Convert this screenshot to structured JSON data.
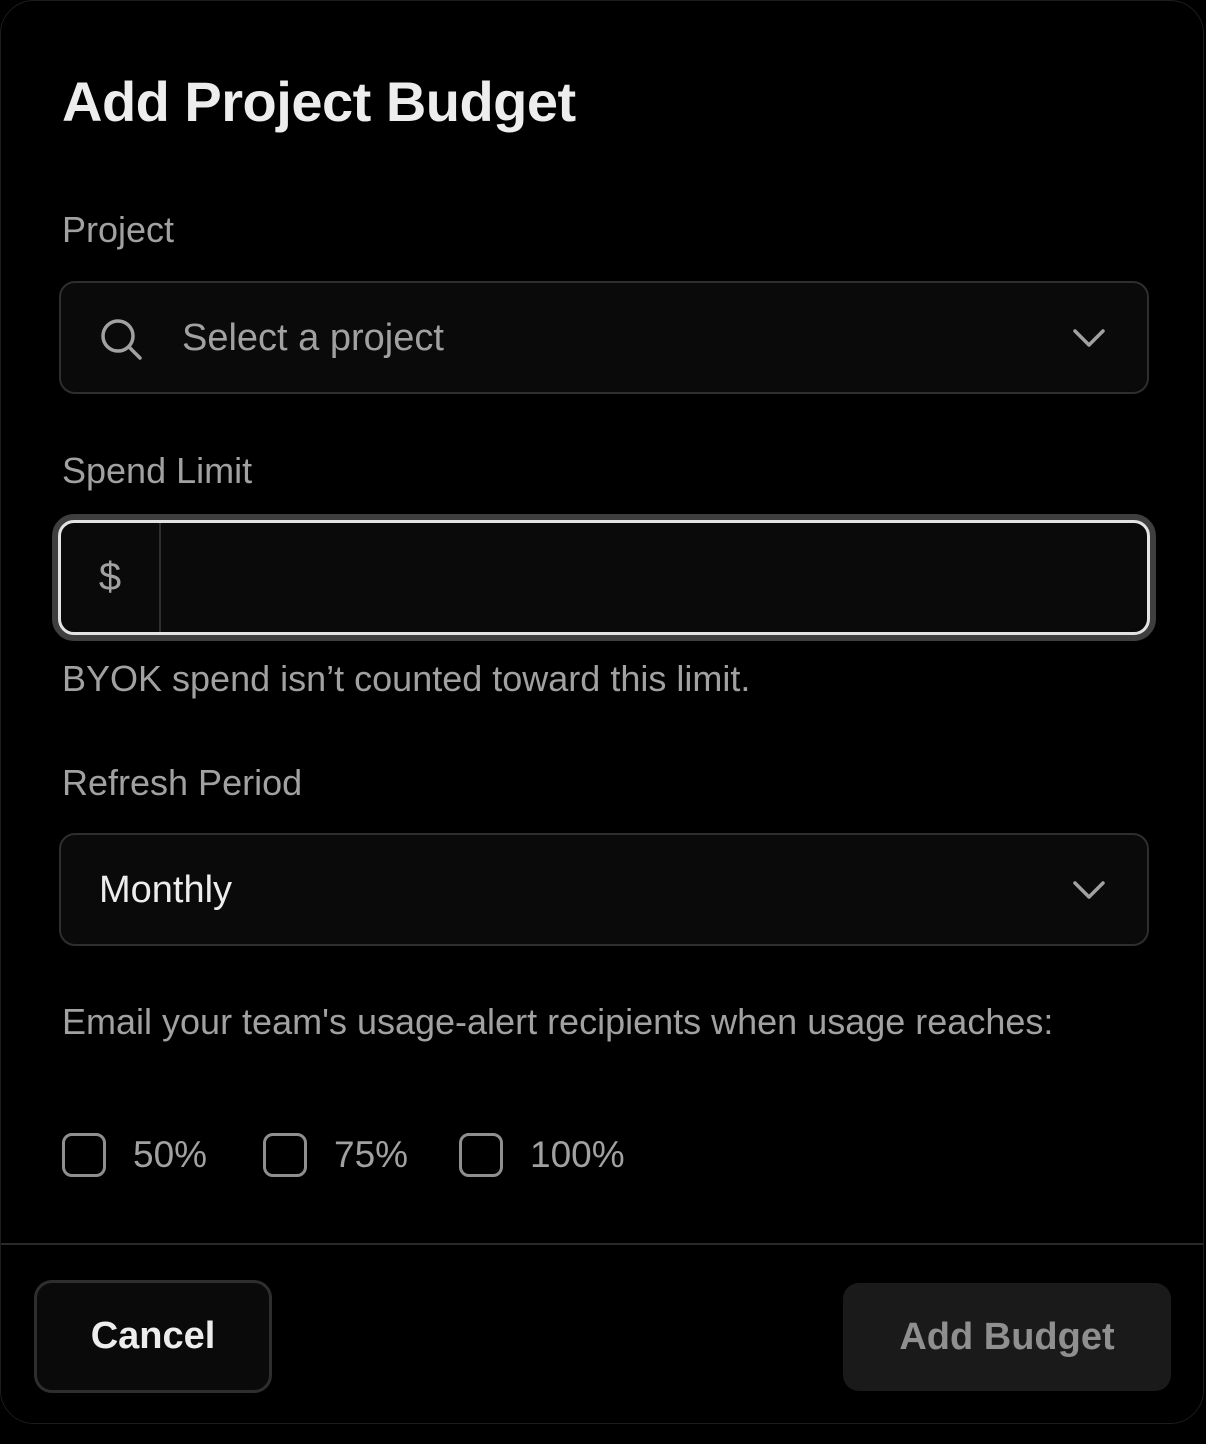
{
  "dialog": {
    "title": "Add Project Budget"
  },
  "project": {
    "label": "Project",
    "placeholder": "Select a project",
    "icon": "search-icon",
    "chevron_icon": "chevron-down-icon"
  },
  "spend_limit": {
    "label": "Spend Limit",
    "currency_symbol": "$",
    "value": "",
    "hint": "BYOK spend isn’t counted toward this limit."
  },
  "refresh_period": {
    "label": "Refresh Period",
    "selected": "Monthly",
    "chevron_icon": "chevron-down-icon"
  },
  "alerts": {
    "description": "Email your team's usage-alert recipients when usage reaches:",
    "options": [
      {
        "label": "50%",
        "checked": false
      },
      {
        "label": "75%",
        "checked": false
      },
      {
        "label": "100%",
        "checked": false
      }
    ]
  },
  "footer": {
    "cancel_label": "Cancel",
    "submit_label": "Add Budget",
    "submit_disabled": true
  },
  "colors": {
    "background": "#000000",
    "text_primary": "#ededed",
    "text_secondary": "#a1a1a1",
    "border": "#2e2e2e",
    "focus_ring": "#e3e3e3"
  }
}
